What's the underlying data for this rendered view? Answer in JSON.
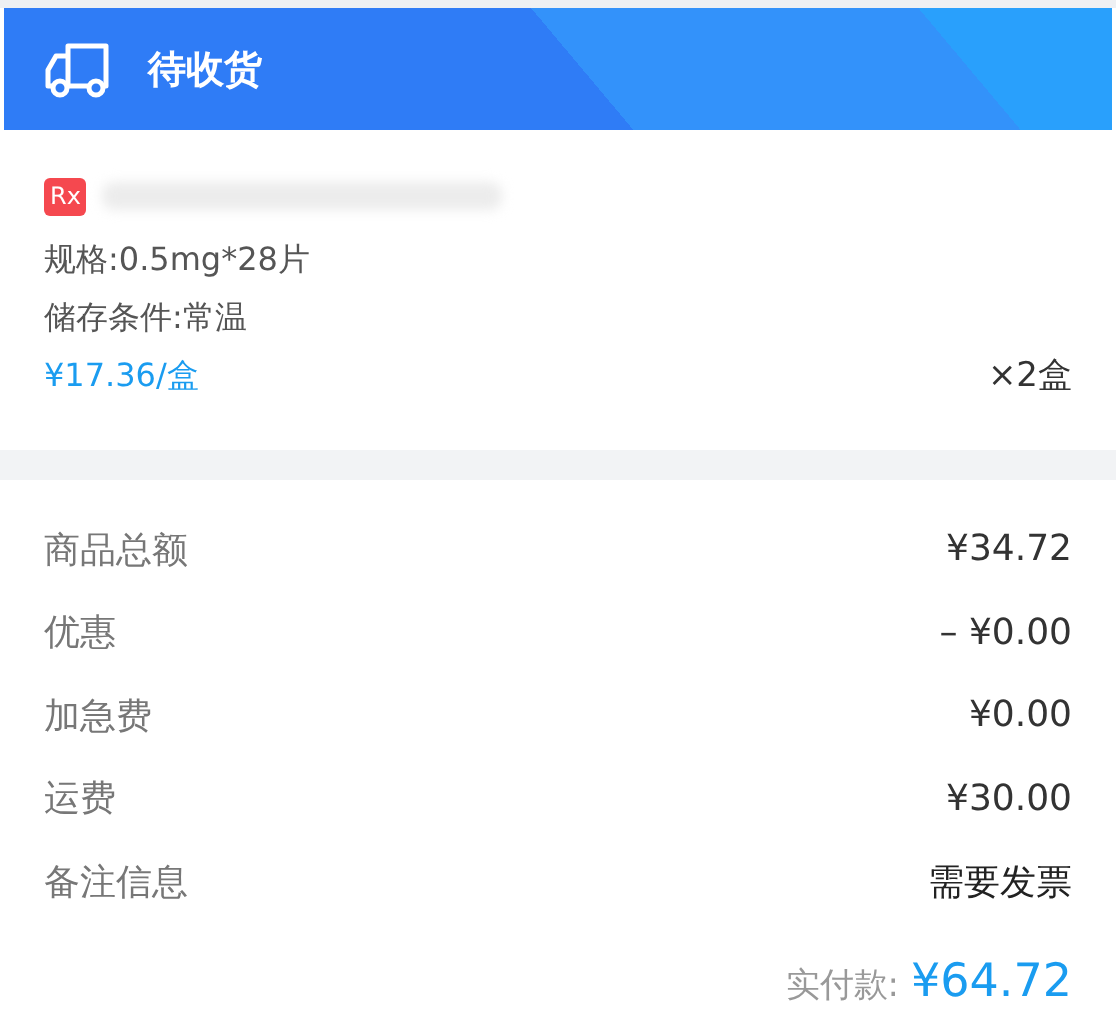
{
  "header": {
    "title": "待收货"
  },
  "product": {
    "badge": "Rx",
    "spec": "规格:0.5mg*28片",
    "storage": "储存条件:常温",
    "price": "¥17.36/盒",
    "quantity": "×2盒"
  },
  "summary": [
    {
      "label": "商品总额",
      "value": "¥34.72"
    },
    {
      "label": "优惠",
      "value": "– ¥0.00"
    },
    {
      "label": "加急费",
      "value": "¥0.00"
    },
    {
      "label": "运费",
      "value": "¥30.00"
    },
    {
      "label": "备注信息",
      "value": "需要发票",
      "kind": "note"
    }
  ],
  "total": {
    "label": "实付款:",
    "value": "¥64.72"
  }
}
